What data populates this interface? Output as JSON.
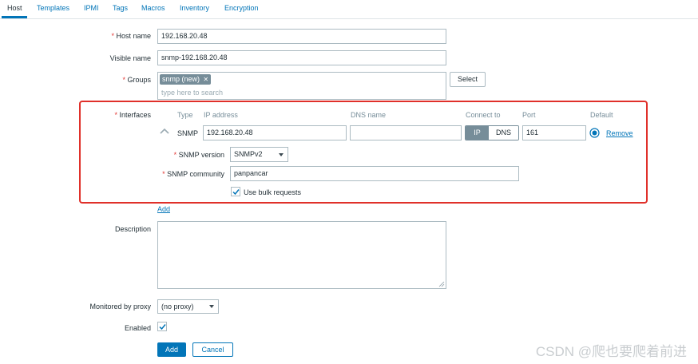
{
  "tabs": [
    "Host",
    "Templates",
    "IPMI",
    "Tags",
    "Macros",
    "Inventory",
    "Encryption"
  ],
  "form": {
    "required_mark": "*",
    "host_name_label": "Host name",
    "host_name_value": "192.168.20.48",
    "visible_name_label": "Visible name",
    "visible_name_value": "snmp-192.168.20.48",
    "groups_label": "Groups",
    "group_tag": "snmp (new)",
    "group_tag_close": "✕",
    "groups_placeholder": "type here to search",
    "select_button": "Select",
    "interfaces_label": "Interfaces",
    "interface_headers": {
      "type": "Type",
      "ip": "IP address",
      "dns": "DNS name",
      "connect": "Connect to",
      "port": "Port",
      "default": "Default"
    },
    "interface": {
      "type": "SNMP",
      "ip": "192.168.20.48",
      "dns": "",
      "connect_ip": "IP",
      "connect_dns": "DNS",
      "port": "161",
      "remove": "Remove"
    },
    "snmp_version_label": "SNMP version",
    "snmp_version_value": "SNMPv2",
    "snmp_community_label": "SNMP community",
    "snmp_community_value": "panpancar",
    "bulk_label": "Use bulk requests",
    "bulk_checked": true,
    "add_link": "Add",
    "description_label": "Description",
    "description_value": "",
    "proxy_label": "Monitored by proxy",
    "proxy_value": "(no proxy)",
    "enabled_label": "Enabled",
    "enabled_checked": true,
    "add_button": "Add",
    "cancel_button": "Cancel"
  },
  "watermark": "CSDN @爬也要爬着前进",
  "colors": {
    "accent": "#0275b8",
    "active_toggle": "#768d99",
    "highlight_box": "#e0302a",
    "required": "#e33734"
  },
  "icons": [
    "chevron-up-icon",
    "close-icon",
    "chevron-down-icon",
    "radio-selected-icon",
    "checkmark-icon",
    "resize-grip-icon"
  ]
}
